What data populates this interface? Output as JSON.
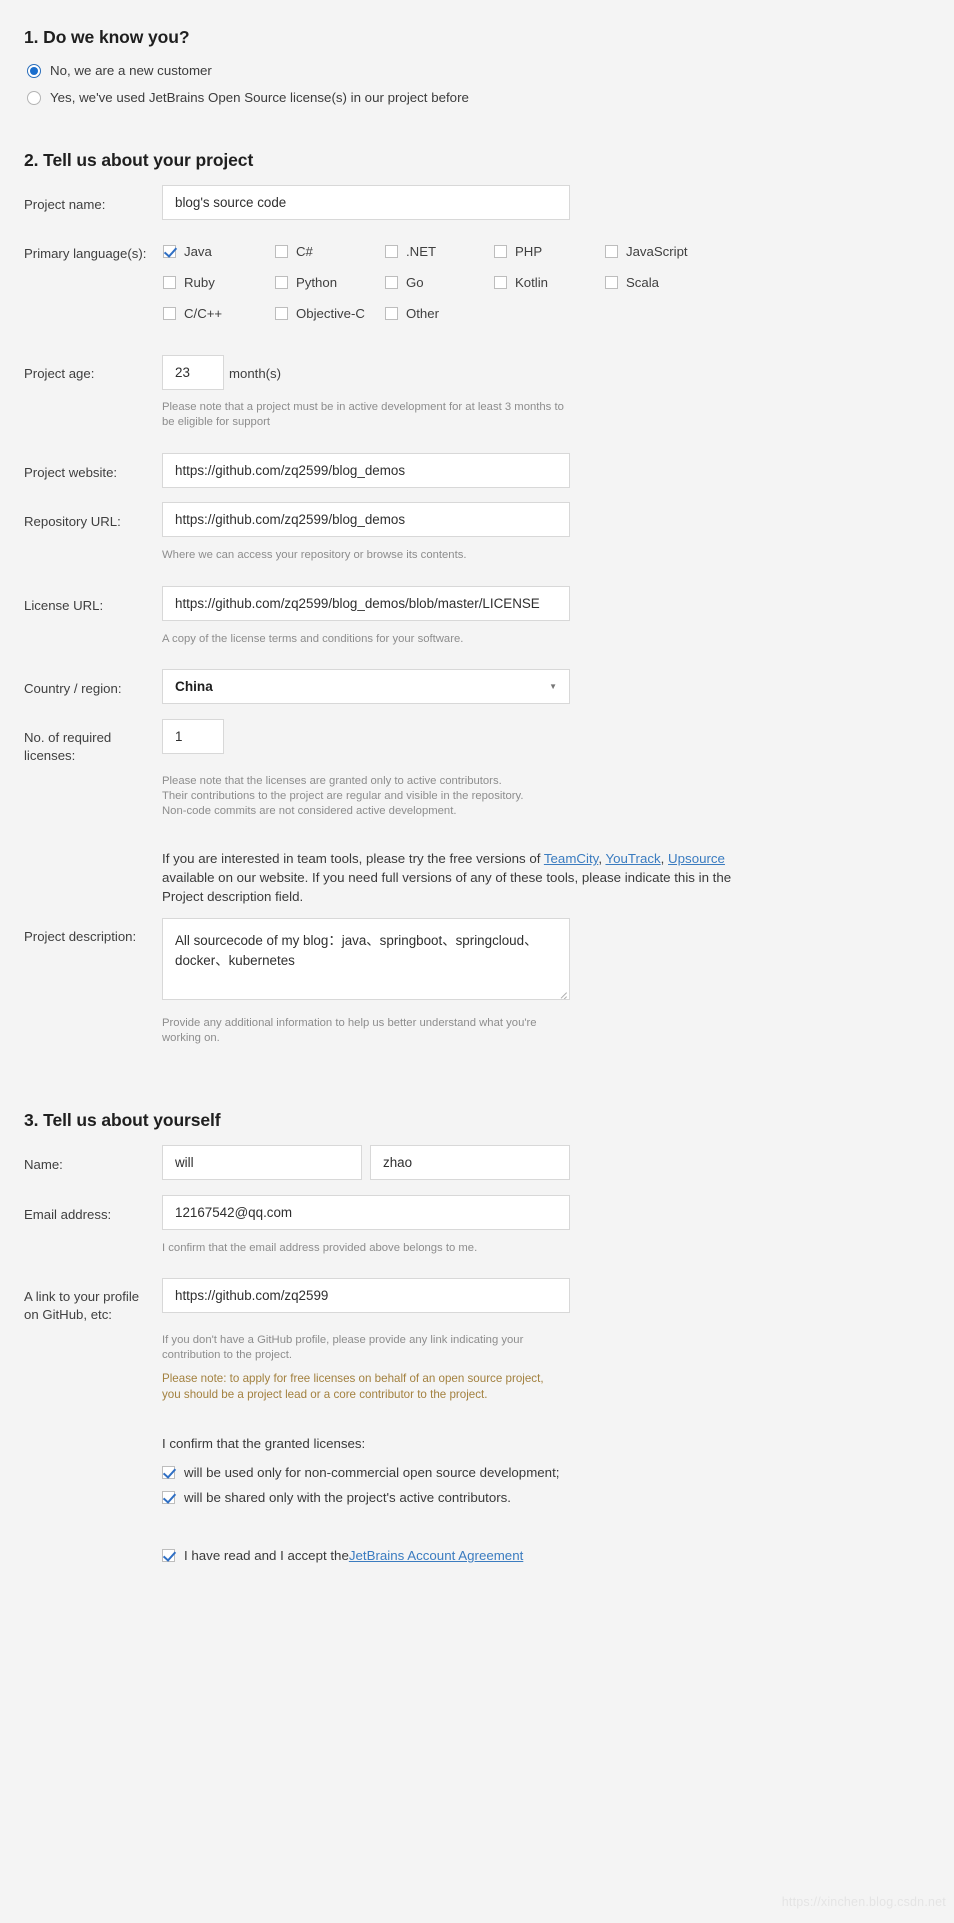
{
  "sections": {
    "one": {
      "title": "1.  Do we know you?",
      "options": [
        {
          "label": "No, we are a new customer",
          "selected": true
        },
        {
          "label": "Yes, we've used JetBrains Open Source license(s) in our project before",
          "selected": false
        }
      ]
    },
    "two": {
      "title": "2. Tell us about your project",
      "project_name": {
        "label": "Project name:",
        "value": "blog's source code"
      },
      "languages": {
        "label": "Primary language(s):",
        "items": [
          {
            "label": "Java",
            "checked": true
          },
          {
            "label": "C#",
            "checked": false
          },
          {
            "label": ".NET",
            "checked": false
          },
          {
            "label": "PHP",
            "checked": false
          },
          {
            "label": "JavaScript",
            "checked": false
          },
          {
            "label": "Ruby",
            "checked": false
          },
          {
            "label": "Python",
            "checked": false
          },
          {
            "label": "Go",
            "checked": false
          },
          {
            "label": "Kotlin",
            "checked": false
          },
          {
            "label": "Scala",
            "checked": false
          },
          {
            "label": "C/C++",
            "checked": false
          },
          {
            "label": "Objective-C",
            "checked": false
          },
          {
            "label": "Other",
            "checked": false
          }
        ]
      },
      "project_age": {
        "label": "Project age:",
        "value": "23",
        "unit": "month(s)",
        "hint_line1": "Please note that a project must be in active development for at least 3 months to",
        "hint_line2": "be eligible for support"
      },
      "project_website": {
        "label": "Project website:",
        "value": "https://github.com/zq2599/blog_demos"
      },
      "repository_url": {
        "label": "Repository URL:",
        "value": "https://github.com/zq2599/blog_demos",
        "hint": "Where we can access your repository or browse its contents."
      },
      "license_url": {
        "label": "License URL:",
        "value": "https://github.com/zq2599/blog_demos/blob/master/LICENSE",
        "hint": "A copy of the license terms and conditions for your software."
      },
      "country": {
        "label": "Country / region:",
        "value": "China",
        "caret": "chevron-down"
      },
      "licenses_count": {
        "label_line1": "No. of required",
        "label_line2": "licenses:",
        "value": "1",
        "hint_line1": "Please note that the licenses are granted only to active contributors.",
        "hint_line2": "Their contributions to the project are regular and visible in the repository.",
        "hint_line3": "Non-code commits are not considered active development."
      },
      "team_tools": {
        "line1_pre": "If you are interested in team tools, please try the free versions of ",
        "link1": "TeamCity",
        "sep1": ", ",
        "link2": "YouTrack",
        "sep2": ", ",
        "link3": "Upsource",
        "line2": "available on our website. If you need full versions of any of these tools, please indicate this in the",
        "line3": "Project description field."
      },
      "project_description": {
        "label": "Project description:",
        "value_line1": "All sourcecode of my blog：java、springboot、springcloud、",
        "value_line2": "docker、kubernetes",
        "hint_line1": "Provide any additional information to help us better understand what you're",
        "hint_line2": "working on."
      }
    },
    "three": {
      "title": "3. Tell us about yourself",
      "name": {
        "label": "Name:",
        "first": "will",
        "last": "zhao"
      },
      "email": {
        "label": "Email address:",
        "value": "12167542@qq.com",
        "hint": "I confirm that the email address provided above belongs to me."
      },
      "profile": {
        "label_line1": "A link to your profile",
        "label_line2": "on GitHub, etc:",
        "value": "https://github.com/zq2599",
        "hint_line1": "If you don't have a GitHub profile, please provide any link indicating your",
        "hint_line2": "contribution to the project.",
        "note_line1": "Please note: to apply for free licenses on behalf of an open source project,",
        "note_line2": "you should be a project lead or a core contributor to the project."
      },
      "confirm": {
        "intro": "I confirm that the granted licenses:",
        "items": [
          {
            "label": "will be used only for non-commercial open source development;",
            "checked": true
          },
          {
            "label": "will be shared only with the project's active contributors.",
            "checked": true
          }
        ],
        "agreement_pre": "I have read and I accept the ",
        "agreement_link": "JetBrains Account Agreement",
        "agreement_checked": true
      }
    }
  },
  "watermark": "https://xinchen.blog.csdn.net",
  "colors": {
    "page_bg": "#f4f4f4",
    "accent_blue": "#3b7cc0",
    "radio_blue": "#1a6ecd",
    "check_blue": "#2f6fc4",
    "note_orange": "#a3813f"
  }
}
